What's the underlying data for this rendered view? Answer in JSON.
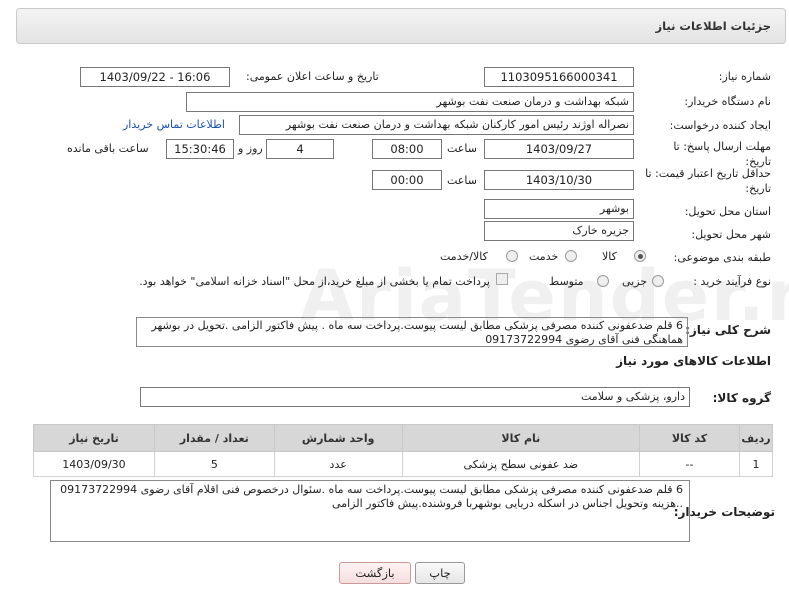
{
  "header": {
    "title": "جزئیات اطلاعات نیاز"
  },
  "fields": {
    "need_number_label": "شماره نیاز:",
    "need_number": "1103095166000341",
    "announce_label": "تاریخ و ساعت اعلان عمومی:",
    "announce_value": "1403/09/22 - 16:06",
    "buyer_label": "نام دستگاه خریدار:",
    "buyer_value": "شبکه بهداشت و درمان صنعت نفت بوشهر",
    "creator_label": "ایجاد کننده درخواست:",
    "creator_value": "نصراله اوژند رئیس امور کارکنان شبکه بهداشت و درمان صنعت نفت بوشهر",
    "contact_link": "اطلاعات تماس خریدار",
    "deadline_label": "مهلت ارسال پاسخ: تا تاریخ:",
    "deadline_date": "1403/09/27",
    "time_label": "ساعت",
    "deadline_time": "08:00",
    "days_value": "4",
    "days_label": "روز و",
    "remaining_time": "15:30:46",
    "remaining_label": "ساعت باقی مانده",
    "validity_label": "حداقل تاریخ اعتبار قیمت: تا تاریخ:",
    "validity_date": "1403/10/30",
    "validity_time_label": "ساعت",
    "validity_time": "00:00",
    "province_label": "استان محل تحویل:",
    "province_value": "بوشهر",
    "city_label": "شهر محل تحویل:",
    "city_value": "جزیره خارک",
    "category_label": "طبقه بندی موضوعی:",
    "category_options": [
      "کالا",
      "خدمت",
      "کالا/خدمت"
    ],
    "process_label": "نوع فرآیند خرید :",
    "process_options": [
      "جزیی",
      "متوسط"
    ],
    "process_note": "پرداخت تمام یا بخشی از مبلغ خرید،از محل \"اسناد خزانه اسلامی\" خواهد بود."
  },
  "description": {
    "label": "شرح کلی نیاز:",
    "text": "6 قلم ضدعفونی کننده مصرفی پزشکی مطابق لیست پیوست.پرداخت سه ماه . پیش فاکتور الزامی .تحویل در بوشهر هماهنگی فنی آقای رضوی 09173722994"
  },
  "goods_section": {
    "title": "اطلاعات کالاهای مورد نیاز",
    "group_label": "گروه کالا:",
    "group_value": "دارو، پزشکی و سلامت"
  },
  "table": {
    "headers": [
      "ردیف",
      "کد کالا",
      "نام کالا",
      "واحد شمارش",
      "تعداد / مقدار",
      "تاریخ نیاز"
    ],
    "rows": [
      [
        "1",
        "--",
        "ضد عفونی سطح پزشکی",
        "عدد",
        "5",
        "1403/09/30"
      ]
    ]
  },
  "buyer_notes": {
    "label": "توضیحات خریدار:",
    "text": "6 قلم ضدعفونی کننده مصرفی پزشکی مطابق  لیست پیوست.پرداخت سه ماه .سئوال درخصوص فنی اقلام آقای رضوی 09173722994  ..هزینه وتحویل اجناس در اسکله دریایی بوشهربا فروشنده.پیش فاکتور الزامی"
  },
  "buttons": {
    "print": "چاپ",
    "back": "بازگشت"
  },
  "watermark": "AriaTender.neT"
}
